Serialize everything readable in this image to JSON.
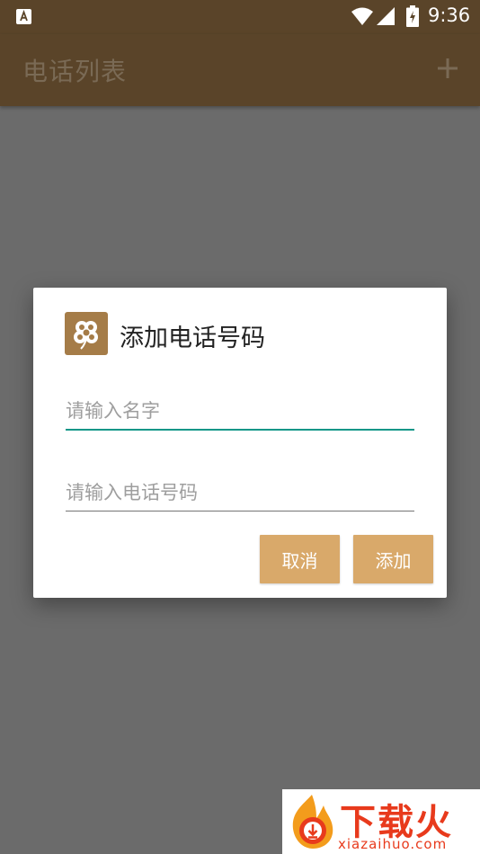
{
  "status_bar": {
    "time": "9:36",
    "icons": [
      "app-notification-icon",
      "wifi-icon",
      "signal-icon",
      "battery-charging-icon"
    ]
  },
  "app_bar": {
    "title": "电话列表",
    "action_icon": "add-icon"
  },
  "dialog": {
    "title": "添加电话号码",
    "icon": "clover-logo-icon",
    "name_field": {
      "placeholder": "请输入名字",
      "value": ""
    },
    "phone_field": {
      "placeholder": "请输入电话号码",
      "value": ""
    },
    "cancel_label": "取消",
    "add_label": "添加"
  },
  "watermark": {
    "text": "下载火",
    "url": "xiazaihuo.com"
  },
  "colors": {
    "app_bar": "#5a4429",
    "scrim_background": "#6b6b6b",
    "button": "#d9a96a",
    "focus_underline": "#0f9688",
    "icon_bg": "#a57c48"
  }
}
